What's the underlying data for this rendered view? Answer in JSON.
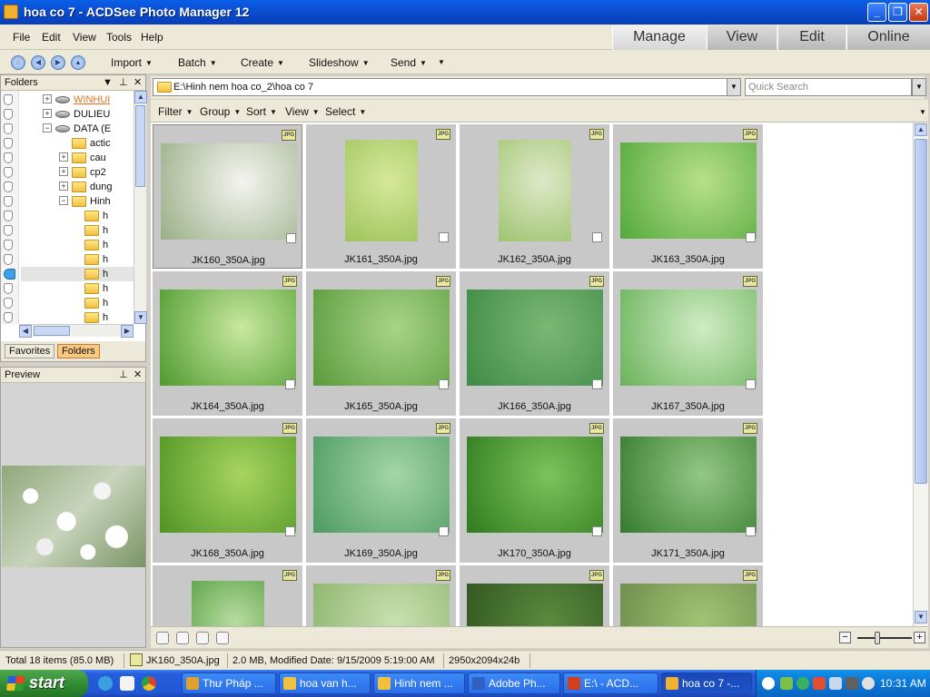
{
  "window": {
    "title": "hoa co 7 - ACDSee Photo Manager 12"
  },
  "menu": {
    "items": [
      {
        "label": "File"
      },
      {
        "label": "Edit"
      },
      {
        "label": "View"
      },
      {
        "label": "Tools"
      },
      {
        "label": "Help"
      }
    ],
    "modes": [
      {
        "label": "Manage"
      },
      {
        "label": "View"
      },
      {
        "label": "Edit"
      },
      {
        "label": "Online"
      }
    ]
  },
  "toolbar": {
    "items": [
      {
        "label": "Import"
      },
      {
        "label": "Batch"
      },
      {
        "label": "Create"
      },
      {
        "label": "Slideshow"
      },
      {
        "label": "Send"
      }
    ]
  },
  "folders_panel": {
    "title": "Folders",
    "tree": [
      {
        "label": "WINHUI",
        "kind": "drive",
        "highlight": true
      },
      {
        "label": "DULIEU",
        "kind": "drive"
      },
      {
        "label": "DATA (E",
        "kind": "drive"
      },
      {
        "label": "actic",
        "kind": "folder"
      },
      {
        "label": "cau",
        "kind": "folder"
      },
      {
        "label": "cp2",
        "kind": "folder"
      },
      {
        "label": "dung",
        "kind": "folder"
      },
      {
        "label": "Hinh",
        "kind": "folder"
      },
      {
        "label": "h",
        "kind": "folder"
      },
      {
        "label": "h",
        "kind": "folder"
      },
      {
        "label": "h",
        "kind": "folder"
      },
      {
        "label": "h",
        "kind": "folder"
      },
      {
        "label": "h",
        "kind": "folder"
      },
      {
        "label": "h",
        "kind": "folder"
      },
      {
        "label": "h",
        "kind": "folder"
      },
      {
        "label": "h",
        "kind": "folder"
      }
    ],
    "tabs": [
      {
        "label": "Favorites"
      },
      {
        "label": "Folders"
      }
    ]
  },
  "preview_panel": {
    "title": "Preview"
  },
  "pathbar": {
    "path": "E:\\Hinh nem hoa co_2\\hoa co 7",
    "search_placeholder": "Quick Search"
  },
  "filterbar": {
    "items": [
      {
        "label": "Filter"
      },
      {
        "label": "Group"
      },
      {
        "label": "Sort"
      },
      {
        "label": "View"
      },
      {
        "label": "Select"
      }
    ]
  },
  "thumbnails": [
    {
      "name": "JK160_350A.jpg",
      "badge": "JPG",
      "colors": [
        "#f4f4f0",
        "#9aae86"
      ],
      "shape": "wide"
    },
    {
      "name": "JK161_350A.jpg",
      "badge": "JPG",
      "colors": [
        "#d6e89a",
        "#9ec45c"
      ],
      "shape": "tall"
    },
    {
      "name": "JK162_350A.jpg",
      "badge": "JPG",
      "colors": [
        "#dfe8c8",
        "#9ec470"
      ],
      "shape": "tall"
    },
    {
      "name": "JK163_350A.jpg",
      "badge": "JPG",
      "colors": [
        "#b8e08a",
        "#52a83a"
      ],
      "shape": "wide"
    },
    {
      "name": "JK164_350A.jpg",
      "badge": "JPG",
      "colors": [
        "#c8e8a0",
        "#4e9a2e"
      ],
      "shape": "wide"
    },
    {
      "name": "JK165_350A.jpg",
      "badge": "JPG",
      "colors": [
        "#a8d488",
        "#5a9a3c"
      ],
      "shape": "wide"
    },
    {
      "name": "JK166_350A.jpg",
      "badge": "JPG",
      "colors": [
        "#7ab874",
        "#3e8a46"
      ],
      "shape": "wide"
    },
    {
      "name": "JK167_350A.jpg",
      "badge": "JPG",
      "colors": [
        "#d0ecc4",
        "#6ab25a"
      ],
      "shape": "wide"
    },
    {
      "name": "JK168_350A.jpg",
      "badge": "JPG",
      "colors": [
        "#a8d460",
        "#4e9424"
      ],
      "shape": "wide"
    },
    {
      "name": "JK169_350A.jpg",
      "badge": "JPG",
      "colors": [
        "#a4d6a8",
        "#4c9a62"
      ],
      "shape": "wide"
    },
    {
      "name": "JK170_350A.jpg",
      "badge": "JPG",
      "colors": [
        "#7cc45a",
        "#2e7a1e"
      ],
      "shape": "wide"
    },
    {
      "name": "JK171_350A.jpg",
      "badge": "JPG",
      "colors": [
        "#94c884",
        "#347a2e"
      ],
      "shape": "wide"
    },
    {
      "name": "",
      "badge": "JPG",
      "colors": [
        "#b8dca0",
        "#4e9a3a"
      ],
      "shape": "tall"
    },
    {
      "name": "",
      "badge": "JPG",
      "colors": [
        "#c8e0b0",
        "#8ab46a"
      ],
      "shape": "wide"
    },
    {
      "name": "",
      "badge": "JPG",
      "colors": [
        "#5c8a3e",
        "#2e5420"
      ],
      "shape": "wide"
    },
    {
      "name": "",
      "badge": "JPG",
      "colors": [
        "#a0c474",
        "#6a8a4a"
      ],
      "shape": "wide"
    }
  ],
  "statusbar": {
    "total": "Total 18 items  (85.0 MB)",
    "file": "JK160_350A.jpg",
    "info": "2.0 MB, Modified Date: 9/15/2009 5:19:00 AM",
    "dims": "2950x2094x24b"
  },
  "taskbar": {
    "start_label": "start",
    "tasks": [
      {
        "label": "Thư Pháp ...",
        "color": "#e0a030"
      },
      {
        "label": "hoa van h...",
        "color": "#f0c040"
      },
      {
        "label": "Hinh nem ...",
        "color": "#f0c040"
      },
      {
        "label": "Adobe Ph...",
        "color": "#3060c0"
      },
      {
        "label": "E:\\ - ACD...",
        "color": "#d04020"
      },
      {
        "label": "hoa co 7 -...",
        "color": "#f0b030",
        "active": true
      }
    ],
    "clock": "10:31 AM"
  }
}
